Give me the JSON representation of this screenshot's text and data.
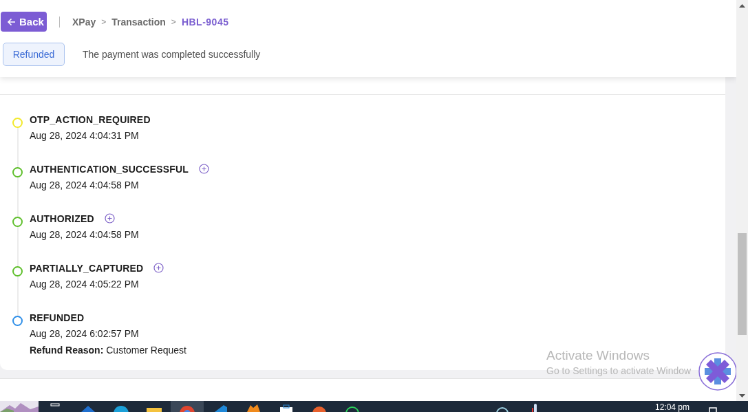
{
  "header": {
    "back_button": "Back",
    "breadcrumb": [
      {
        "label": "XPay",
        "current": false
      },
      {
        "label": "Transaction",
        "current": false
      },
      {
        "label": "HBL-9045",
        "current": true
      }
    ],
    "separator": ">",
    "status_badge": "Refunded",
    "message": "The payment was completed successfully"
  },
  "timeline": [
    {
      "title": "OTP_ACTION_REQUIRED",
      "time": "Aug 28, 2024 4:04:31 PM",
      "color": "#f2e92b",
      "expandable": false
    },
    {
      "title": "AUTHENTICATION_SUCCESSFUL",
      "time": "Aug 28, 2024 4:04:58 PM",
      "color": "#5fbf2c",
      "expandable": true
    },
    {
      "title": "AUTHORIZED",
      "time": "Aug 28, 2024 4:04:58 PM",
      "color": "#5fbf2c",
      "expandable": true
    },
    {
      "title": "PARTIALLY_CAPTURED",
      "time": "Aug 28, 2024 4:05:22 PM",
      "color": "#5fbf2c",
      "expandable": true
    },
    {
      "title": "REFUNDED",
      "time": "Aug 28, 2024 6:02:57 PM",
      "color": "#2f8fe8",
      "expandable": false,
      "note": "**Refund Reason:** Customer Request"
    }
  ],
  "activation_notice": {
    "title": "Activate Windows",
    "subtitle": "Go to Settings to activate Window"
  },
  "taskbar": {
    "clock": "12:04 pm"
  }
}
